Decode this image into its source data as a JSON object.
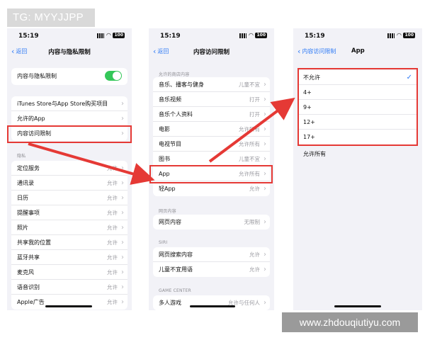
{
  "watermarks": {
    "top_left": "TG: MYYJJPP",
    "bottom_right": "www.zhdouqiutiyu.com"
  },
  "accent_color": "#2f7bf6",
  "highlight_color": "#e53935",
  "toggle_color": "#34c759",
  "status_bar": {
    "time": "15:19",
    "battery": "100"
  },
  "icons": [
    "back-chevron-icon",
    "disclosure-chevron-icon",
    "checkmark-icon",
    "signal-icon",
    "wifi-icon",
    "battery-icon",
    "arrow-icon"
  ],
  "screen1": {
    "back_label": "返回",
    "title": "内容与隐私限制",
    "toggle_label": "内容与隐私限制",
    "toggle_on": true,
    "items": [
      "iTunes Store与App Store购买项目",
      "允许的App",
      "内容访问限制"
    ],
    "privacy_label": "隐私",
    "privacy_items": [
      {
        "label": "定位服务",
        "value": "允许"
      },
      {
        "label": "通讯录",
        "value": "允许"
      },
      {
        "label": "日历",
        "value": "允许"
      },
      {
        "label": "提醒事项",
        "value": "允许"
      },
      {
        "label": "照片",
        "value": "允许"
      },
      {
        "label": "共享我的位置",
        "value": "允许"
      },
      {
        "label": "蓝牙共享",
        "value": "允许"
      },
      {
        "label": "麦克风",
        "value": "允许"
      },
      {
        "label": "语音识别",
        "value": "允许"
      },
      {
        "label": "Apple广告",
        "value": "允许"
      }
    ]
  },
  "screen2": {
    "back_label": "返回",
    "title": "内容访问限制",
    "store_section_label": "允许的商店内容",
    "store_items": [
      {
        "label": "音乐、播客与健身",
        "value": "儿童不宜"
      },
      {
        "label": "音乐视频",
        "value": "打开"
      },
      {
        "label": "音乐个人资料",
        "value": "打开"
      },
      {
        "label": "电影",
        "value": "允许所有"
      },
      {
        "label": "电视节目",
        "value": "允许所有"
      },
      {
        "label": "图书",
        "value": "儿童不宜"
      },
      {
        "label": "App",
        "value": "允许所有"
      },
      {
        "label": "轻App",
        "value": "允许"
      }
    ],
    "web_section_label": "网页内容",
    "web_items": [
      {
        "label": "网页内容",
        "value": "无限制"
      }
    ],
    "siri_section_label": "SIRI",
    "siri_items": [
      {
        "label": "网页搜索内容",
        "value": "允许"
      },
      {
        "label": "儿童不宜用语",
        "value": "允许"
      }
    ],
    "game_section_label": "GAME CENTER",
    "game_items": [
      {
        "label": "多人游戏",
        "value": "允许与任何人"
      }
    ]
  },
  "screen3": {
    "back_label": "内容访问限制",
    "title": "App",
    "options": [
      "不允许",
      "4+",
      "9+",
      "12+",
      "17+"
    ],
    "selected_index": 0,
    "allow_all_label": "允许所有"
  }
}
